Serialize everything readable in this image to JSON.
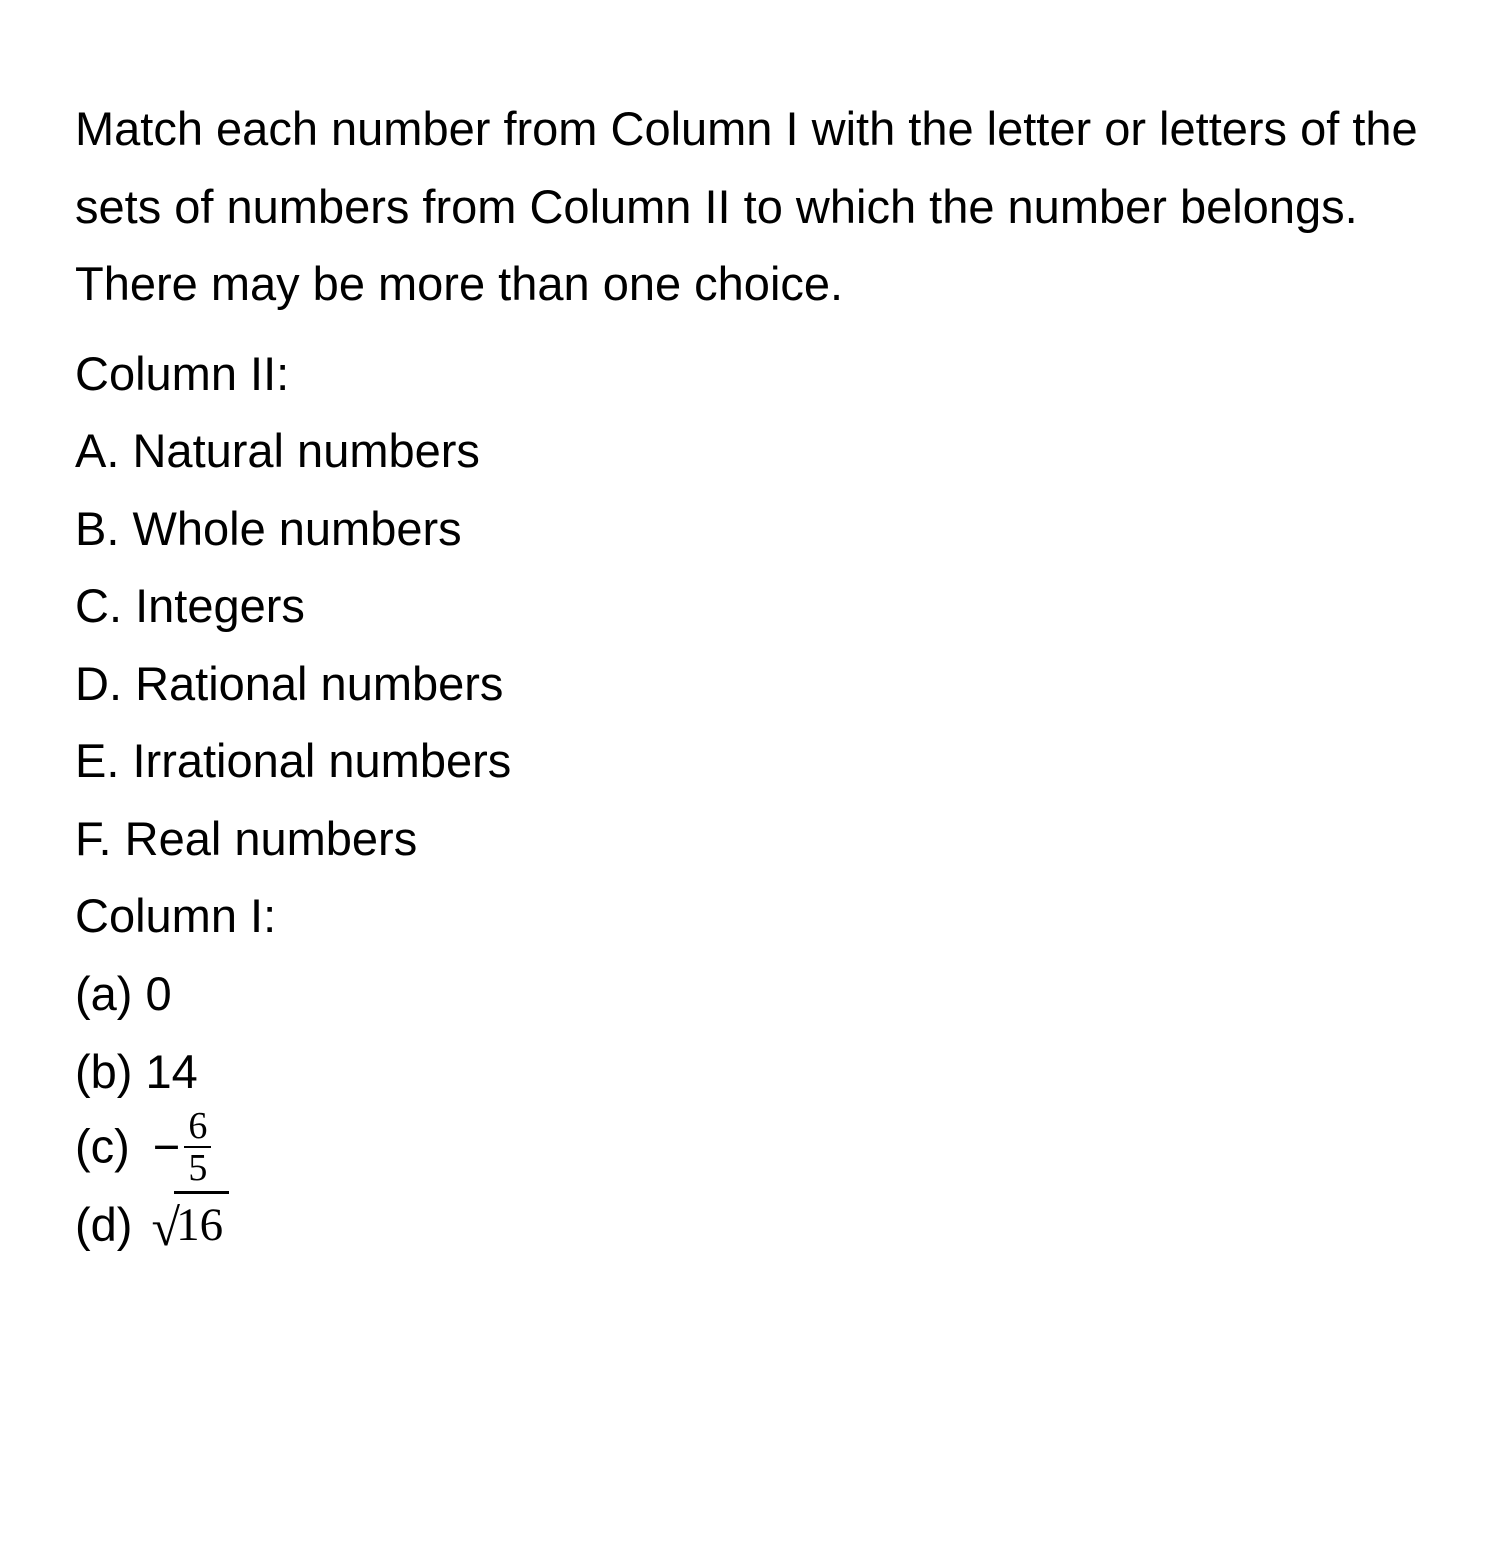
{
  "instruction": "Match each number from Column I with the letter or letters of the sets of numbers from Column II to which the number belongs. There may be more than one choice.",
  "column2": {
    "header": "Column II:",
    "items": [
      {
        "letter": "A.",
        "label": "Natural numbers"
      },
      {
        "letter": "B.",
        "label": "Whole numbers"
      },
      {
        "letter": "C.",
        "label": "Integers"
      },
      {
        "letter": "D.",
        "label": "Rational numbers"
      },
      {
        "letter": "E.",
        "label": "Irrational numbers"
      },
      {
        "letter": "F.",
        "label": "Real numbers"
      }
    ]
  },
  "column1": {
    "header": "Column I:",
    "items": [
      {
        "letter": "(a)",
        "value": "0"
      },
      {
        "letter": "(b)",
        "value": "14"
      },
      {
        "letter": "(c)",
        "value_prefix": "−",
        "fraction_num": "6",
        "fraction_den": "5"
      },
      {
        "letter": "(d)",
        "sqrt_radicand": "16"
      }
    ]
  }
}
